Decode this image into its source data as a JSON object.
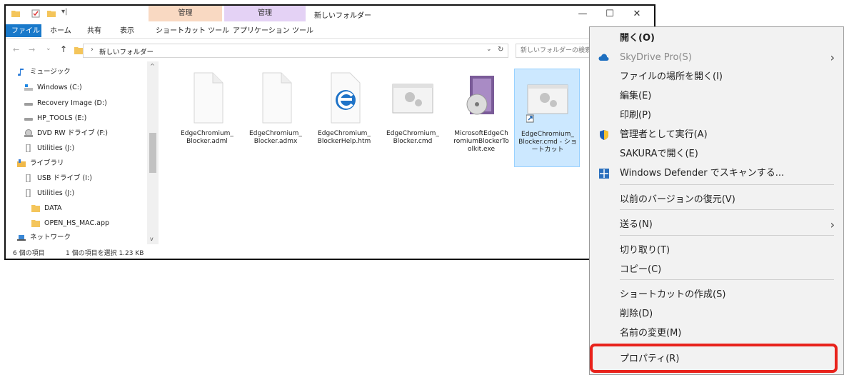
{
  "explorer": {
    "title": "新しいフォルダー",
    "context_tabs": [
      {
        "header": "管理",
        "sub": "ショートカット ツール"
      },
      {
        "header": "管理",
        "sub": "アプリケーション ツール"
      }
    ],
    "ribbon_tabs": [
      "ファイル",
      "ホーム",
      "共有",
      "表示"
    ],
    "controls": {
      "minimize": "—",
      "maximize": "☐",
      "close": "✕"
    },
    "address": {
      "crumb": "新しいフォルダー"
    },
    "search": {
      "placeholder": "新しいフォルダーの検索"
    },
    "nav_items": [
      {
        "label": "ミュージック",
        "icon": "music-icon"
      },
      {
        "label": "Windows (C:)",
        "icon": "windows-drive-icon"
      },
      {
        "label": "Recovery Image (D:)",
        "icon": "drive-icon"
      },
      {
        "label": "HP_TOOLS (E:)",
        "icon": "drive-icon"
      },
      {
        "label": "DVD RW ドライブ (F:)",
        "icon": "dvd-drive-icon"
      },
      {
        "label": "Utilities (J:)",
        "icon": "usb-drive-icon"
      },
      {
        "label": "ライブラリ",
        "icon": "library-icon"
      },
      {
        "label": "USB ドライブ (I:)",
        "icon": "usb-drive-icon"
      },
      {
        "label": "Utilities (J:)",
        "icon": "usb-drive-icon"
      },
      {
        "label": "DATA",
        "icon": "folder-icon"
      },
      {
        "label": "OPEN_HS_MAC.app",
        "icon": "folder-icon"
      },
      {
        "label": "ネットワーク",
        "icon": "network-icon"
      }
    ],
    "files": [
      {
        "name": "EdgeChromium_ Blocker.adml",
        "icon": "blank-file-icon"
      },
      {
        "name": "EdgeChromium_ Blocker.admx",
        "icon": "blank-file-icon"
      },
      {
        "name": "EdgeChromium_ BlockerHelp.htm",
        "icon": "edge-html-file-icon"
      },
      {
        "name": "EdgeChromium_ Blocker.cmd",
        "icon": "cmd-file-icon"
      },
      {
        "name": "MicrosoftEdgeCh romiumBlockerTo olkit.exe",
        "icon": "installer-exe-icon"
      },
      {
        "name": "EdgeChromium_ Blocker.cmd - ショ ートカット",
        "icon": "cmd-shortcut-icon"
      }
    ],
    "status": {
      "count": "6 個の項目",
      "selection": "1 個の項目を選択  1.23 KB"
    }
  },
  "context_menu": {
    "items": [
      {
        "label": "開く(O)",
        "bold": true
      },
      {
        "label": "SkyDrive Pro(S)",
        "disabled": true,
        "icon": "skydrive-cloud-icon",
        "submenu": true
      },
      {
        "label": "ファイルの場所を開く(I)"
      },
      {
        "label": "編集(E)"
      },
      {
        "label": "印刷(P)"
      },
      {
        "label": "管理者として実行(A)",
        "icon": "uac-shield-icon"
      },
      {
        "label": "SAKURAで開く(E)"
      },
      {
        "label": "Windows Defender でスキャンする...",
        "icon": "defender-icon"
      },
      {
        "label": "以前のバージョンの復元(V)"
      },
      {
        "label": "送る(N)",
        "submenu": true
      },
      {
        "label": "切り取り(T)"
      },
      {
        "label": "コピー(C)"
      },
      {
        "label": "ショートカットの作成(S)"
      },
      {
        "label": "削除(D)"
      },
      {
        "label": "名前の変更(M)"
      },
      {
        "label": "プロパティ(R)"
      }
    ]
  },
  "colors": {
    "accent": "#1979ca",
    "highlight_border": "#e8231c",
    "context_tab_pink": "#f9d9c2",
    "context_tab_purple": "#e4d2f5",
    "selection": "#cce8ff"
  }
}
